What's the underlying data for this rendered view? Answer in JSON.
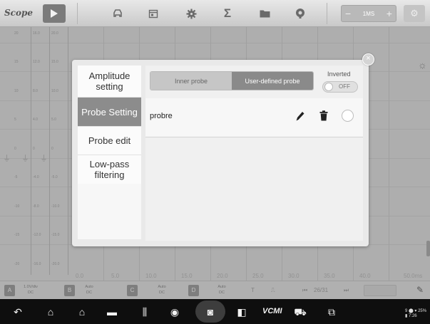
{
  "topbar": {
    "brand": "Scope",
    "timebase_minus": "−",
    "timebase_value": "1MS",
    "timebase_plus": "+",
    "icons": [
      "play-icon",
      "car-icon",
      "calendar-icon",
      "gear-icon",
      "sigma-icon",
      "folder-icon",
      "marker-icon",
      "settings-icon"
    ]
  },
  "scope": {
    "left_scales": [
      [
        "20",
        "15",
        "10",
        "5",
        "0",
        "-5",
        "-10",
        "-15",
        "-20"
      ],
      [
        "16.0",
        "12.0",
        "8.0",
        "4.0",
        "0",
        "-4.0",
        "-8.0",
        "-12.0",
        "-16.0"
      ],
      [
        "20.0",
        "15.0",
        "10.0",
        "5.0",
        "0",
        "-5.0",
        "-10.0",
        "-15.0",
        "-20.0"
      ]
    ],
    "x_ticks": [
      "0.0",
      "5.0",
      "10.0",
      "15.0",
      "20.0",
      "25.0",
      "30.0",
      "35.0",
      "40.0",
      "50.0ms"
    ]
  },
  "channels": {
    "a_tag": "A",
    "a_val_line1": "1.0V/div",
    "a_val_line2": "DC",
    "b_tag": "B",
    "b_val_line1": "Auto",
    "b_val_line2": "DC",
    "c_tag": "C",
    "c_val_line1": "Auto",
    "c_val_line2": "DC",
    "d_tag": "D",
    "d_val_line1": "Auto",
    "d_val_line2": "DC",
    "page": "26/31"
  },
  "dialog": {
    "menu": [
      {
        "label": "Amplitude setting",
        "active": false
      },
      {
        "label": "Probe Setting",
        "active": true
      },
      {
        "label": "Probe edit",
        "active": false
      },
      {
        "label": "Low-pass filtering",
        "active": false
      }
    ],
    "tabs": {
      "inner": "Inner probe",
      "user": "User-defined probe"
    },
    "inverted_label": "Inverted",
    "inverted_state": "OFF",
    "probe_name": "probre"
  },
  "navbar": {
    "vcm_label": "VCMI",
    "status": "9 ⬤ ▾ 25% ▮ 7:26"
  },
  "colors": {
    "active_tab": "#8a8a8a",
    "inactive_tab": "#c6c6c6",
    "navbar": "#0e0e0e"
  }
}
